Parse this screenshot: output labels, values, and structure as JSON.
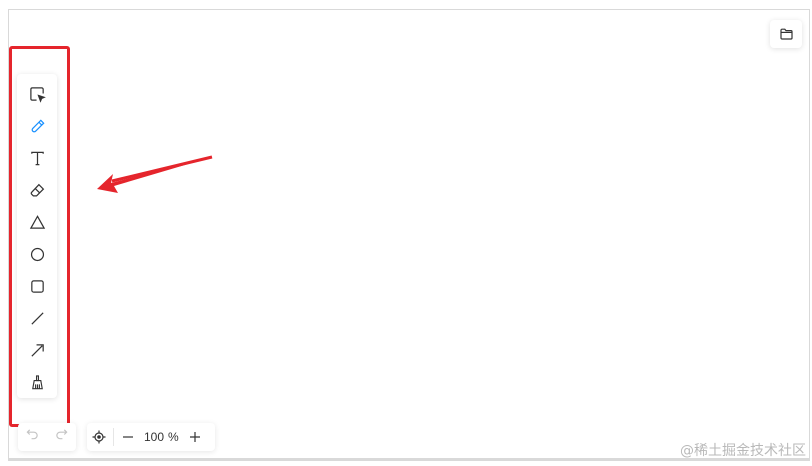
{
  "toolbar": {
    "tools": [
      {
        "icon": "select-icon",
        "active": false
      },
      {
        "icon": "pen-icon",
        "active": true
      },
      {
        "icon": "text-icon",
        "active": false
      },
      {
        "icon": "eraser-icon",
        "active": false
      },
      {
        "icon": "triangle-icon",
        "active": false
      },
      {
        "icon": "circle-icon",
        "active": false
      },
      {
        "icon": "rectangle-icon",
        "active": false
      },
      {
        "icon": "line-icon",
        "active": false
      },
      {
        "icon": "arrow-icon",
        "active": false
      },
      {
        "icon": "broom-icon",
        "active": false
      }
    ],
    "active_color": "#1890ff"
  },
  "history": {
    "undo_icon": "undo-icon",
    "redo_icon": "redo-icon"
  },
  "zoom": {
    "value": "100",
    "unit": "%"
  },
  "file_button": {
    "icon": "folder-icon"
  },
  "annotation": {
    "box_color": "#e5252c",
    "arrow_color": "#e5252c"
  },
  "watermark": "@稀土掘金技术社区"
}
